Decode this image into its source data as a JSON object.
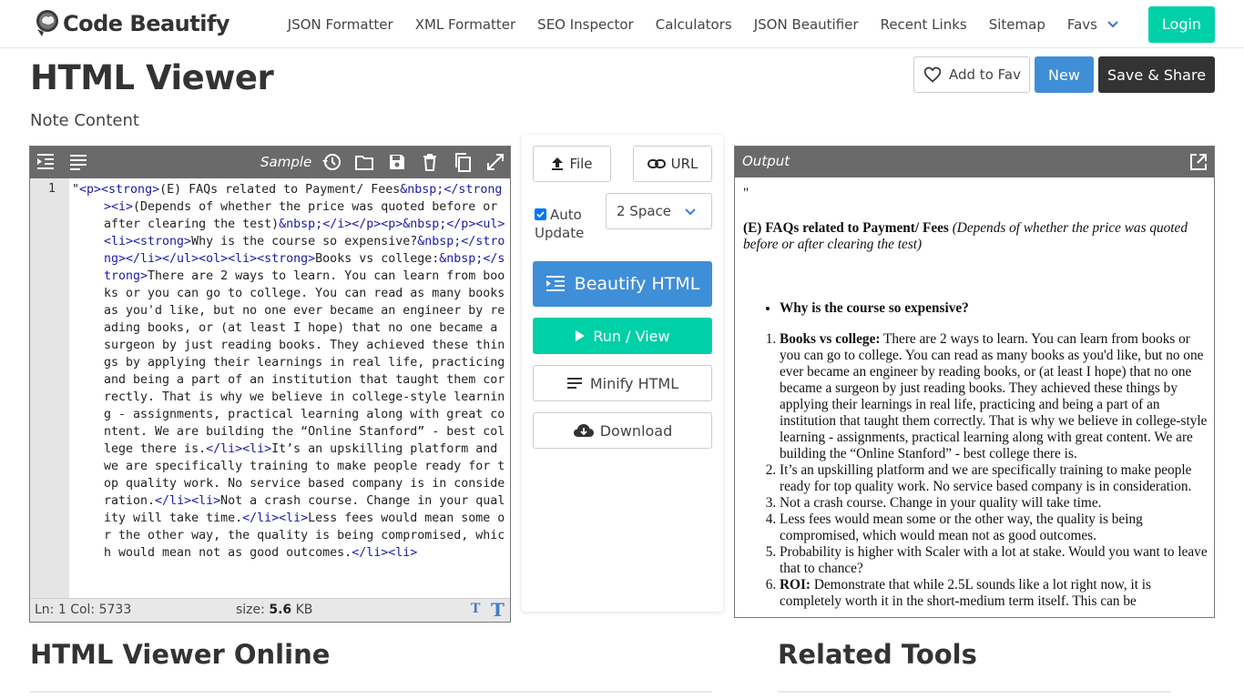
{
  "brand": {
    "name": "Code Beautify"
  },
  "nav": {
    "links": [
      "JSON Formatter",
      "XML Formatter",
      "SEO Inspector",
      "Calculators",
      "JSON Beautifier",
      "Recent Links",
      "Sitemap"
    ],
    "favs_label": "Favs",
    "login_label": "Login"
  },
  "header": {
    "title": "HTML Viewer",
    "note_title": "Note Content",
    "add_fav_label": "Add to Fav",
    "new_label": "New",
    "save_share_label": "Save & Share"
  },
  "editor": {
    "sample_label": "Sample",
    "line_number": "1",
    "code_html": "\"<span class=\"tag\">&lt;p&gt;&lt;strong&gt;</span>(E) FAQs related to Payment/ Fees<span class=\"ent\">&amp;nbsp;</span><span class=\"tag\">&lt;/strong&gt;&lt;i&gt;</span>(Depends of whether the price was quoted before or after clearing the test)<span class=\"ent\">&amp;nbsp;</span><span class=\"tag\">&lt;/i&gt;&lt;/p&gt;&lt;p&gt;</span><span class=\"ent\">&amp;nbsp;</span><span class=\"tag\">&lt;/p&gt;&lt;ul&gt;&lt;li&gt;&lt;strong&gt;</span>Why is the course so expensive?<span class=\"ent\">&amp;nbsp;</span><span class=\"tag\">&lt;/strong&gt;&lt;/li&gt;&lt;/ul&gt;&lt;ol&gt;&lt;li&gt;&lt;strong&gt;</span>Books vs college:<span class=\"ent\">&amp;nbsp;</span><span class=\"tag\">&lt;/strong&gt;</span>There are 2 ways to learn. You can learn from books or you can go to college. You can read as many books as you'd like, but no one ever became an engineer by reading books, or (at least I hope) that no one became a surgeon by just reading books. They achieved these things by applying their learnings in real life, practicing and being a part of an institution that taught them correctly. That is why we believe in college-style learning - assignments, practical learning along with great content. We are building the “Online Stanford” - best college there is.<span class=\"tag\">&lt;/li&gt;&lt;li&gt;</span>It’s an upskilling platform and we are specifically training to make people ready for top quality work. No service based company is in consideration.<span class=\"tag\">&lt;/li&gt;&lt;li&gt;</span>Not a crash course. Change in your quality will take time.<span class=\"tag\">&lt;/li&gt;&lt;li&gt;</span>Less fees would mean some or the other way, the quality is being compromised, which would mean not as good outcomes.<span class=\"tag\">&lt;/li&gt;&lt;li&gt;</span>",
    "status_position": "Ln: 1 Col: 5733",
    "size_label": "size:",
    "size_value": "5.6",
    "size_unit": "KB"
  },
  "controls": {
    "file_label": "File",
    "url_label": "URL",
    "auto_update_line1": "Auto",
    "auto_update_line2": "Update",
    "indent_value": "2 Space",
    "beautify_label": "Beautify HTML",
    "run_label": "Run / View",
    "minify_label": "Minify HTML",
    "download_label": "Download"
  },
  "output": {
    "label": "Output",
    "quote": "\"",
    "faq_title": "(E) FAQs related to Payment/ Fees",
    "faq_note": "(Depends of whether the price was quoted before or after clearing the test)",
    "bullet": "Why is the course so expensive?",
    "items": [
      {
        "bold": "Books vs college:",
        "text": " There are 2 ways to learn. You can learn from books or you can go to college. You can read as many books as you'd like, but no one ever became an engineer by reading books, or (at least I hope) that no one became a surgeon by just reading books. They achieved these things by applying their learnings in real life, practicing and being a part of an institution that taught them correctly. That is why we believe in college-style learning - assignments, practical learning along with great content. We are building the “Online Stanford” - best college there is."
      },
      {
        "bold": "",
        "text": "It’s an upskilling platform and we are specifically training to make people ready for top quality work. No service based company is in consideration."
      },
      {
        "bold": "",
        "text": "Not a crash course. Change in your quality will take time."
      },
      {
        "bold": "",
        "text": "Less fees would mean some or the other way, the quality is being compromised, which would mean not as good outcomes."
      },
      {
        "bold": "",
        "text": "Probability is higher with Scaler with a lot at stake. Would you want to leave that to chance?"
      },
      {
        "bold": "ROI:",
        "text": " Demonstrate that while 2.5L sounds like a lot right now, it is completely worth it in the short-medium term itself. This can be"
      }
    ]
  },
  "sections": {
    "left_heading": "HTML Viewer Online",
    "right_heading": "Related Tools"
  },
  "colors": {
    "accent_blue": "#3f8ed8",
    "accent_teal": "#00d0a8",
    "dark": "#333333",
    "toolbar_gray": "#6a6a6a"
  }
}
